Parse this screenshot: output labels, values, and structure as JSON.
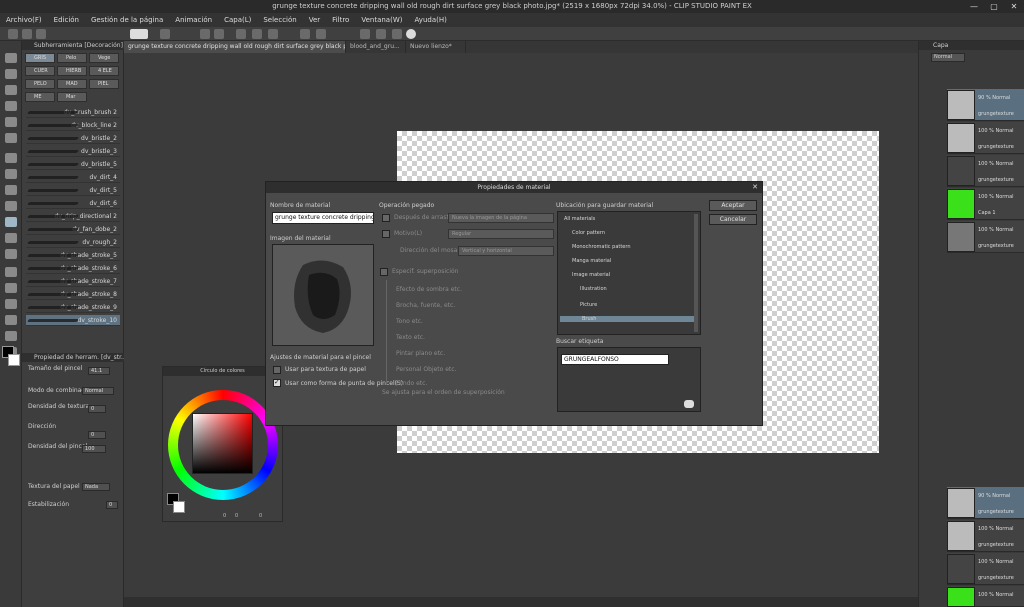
{
  "window": {
    "title": "grunge texture concrete dripping wall old rough dirt surface grey black photo.jpg* (2519 x 1680px 72dpi 34.0%) - CLIP STUDIO PAINT EX",
    "minimize": "—",
    "maximize": "▢",
    "close": "✕"
  },
  "menu": [
    "Archivo(F)",
    "Edición",
    "Gestión de la página",
    "Animación",
    "Capa(L)",
    "Selección",
    "Ver",
    "Filtro",
    "Ventana(W)",
    "Ayuda(H)"
  ],
  "tabs": [
    {
      "label": "grunge texture concrete dripping wall old rough dirt surface grey black photo.jpg*"
    },
    {
      "label": "blood_and_gru..."
    },
    {
      "label": "Nuevo lienzo*"
    }
  ],
  "subtool_panel": {
    "header": "Subherramienta [Decoración]",
    "groups": [
      "GRIS",
      "Pelo",
      "Vege",
      "CUER",
      "HIERB",
      "4 ELE",
      "PELO",
      "MAD",
      "PIEL",
      "ME",
      "Mar"
    ],
    "brushes": [
      "dv_brush_brush 2",
      "dv_block_line 2",
      "dv_bristle_2",
      "dv_bristle_3",
      "dv_bristle_5",
      "dv_dirt_4",
      "dv_dirt_5",
      "dv_dirt_6",
      "dv_drip_directional 2",
      "dv_fan_dobe_2",
      "dv_rough_2",
      "dv_shade_stroke_5",
      "dv_shade_stroke_6",
      "dv_shade_stroke_7",
      "dv_shade_stroke_8",
      "dv_shade_stroke_9",
      "dv_stroke_10"
    ]
  },
  "tool_property": {
    "header": "Propiedad de herram. [dv_str...]",
    "brush_size_label": "Tamaño del pincel",
    "brush_size_value": "41.1",
    "blend_label": "Modo de combinación",
    "blend_value": "Normal",
    "texture_density_label": "Densidad de textura",
    "texture_density_value": "0",
    "direction_label": "Dirección",
    "direction_value": "0",
    "brush_density_label": "Densidad del pincel",
    "brush_density_value": "100",
    "paper_texture_label": "Textura del papel",
    "paper_texture_value": "Nada",
    "stabilization_label": "Estabilización",
    "stabilization_value": "0"
  },
  "color_window": {
    "title": "Círculo de colores",
    "values": [
      "0",
      "0",
      "0"
    ]
  },
  "dialog": {
    "title": "Propiedades de material",
    "name_label": "Nombre de material",
    "name_value": "grunge texture concrete dripping wall",
    "image_label": "Imagen del material",
    "brush_settings_label": "Ajustes de material para el pincel",
    "paper_texture_checkbox": "Usar para textura de papel",
    "brush_tip_checkbox": "Usar como forma de punta de pincel(S)",
    "paste_op_label": "Operación pegado",
    "paste_option1": "Después de arrastrar",
    "paste_option1_value": "Nueva la imagen de la página",
    "pattern_label": "Motivo(L)",
    "pattern_value": "Regular",
    "tiling_label": "Dirección del mosaico",
    "tiling_value": "Vertical y horizontal",
    "overlay_label": "Especif. superposición",
    "overlay_options": [
      "Efecto de sombra etc.",
      "Brocha, fuente, etc.",
      "Tono etc.",
      "Texto etc.",
      "Pintar plano etc.",
      "Personal Objeto etc.",
      "Fondo etc.",
      "Se ajusta para el orden de superposición"
    ],
    "location_label": "Ubicación para guardar material",
    "tree": [
      "All materials",
      "Color pattern",
      "Monochromatic pattern",
      "Manga material",
      "Image material",
      "Illustration",
      "Picture",
      "Brush"
    ],
    "ok_button": "Aceptar",
    "cancel_button": "Cancelar",
    "tag_label": "Buscar etiqueta",
    "tag_value": "GRUNGEALFONSO"
  },
  "layers_panel": {
    "header": "Capa",
    "blend": "Normal",
    "items": [
      {
        "opacity": "90 % Normal",
        "name": "grungetexture"
      },
      {
        "opacity": "100 % Normal",
        "name": "grungetexture"
      },
      {
        "opacity": "100 % Normal",
        "name": "grungetexture"
      },
      {
        "opacity": "100 % Normal",
        "name": "Capa 1"
      },
      {
        "opacity": "100 % Normal",
        "name": "grungetexture"
      }
    ],
    "bottom_items": [
      {
        "opacity": "90 % Normal",
        "name": "grungetexture"
      },
      {
        "opacity": "100 % Normal",
        "name": "grungetexture"
      },
      {
        "opacity": "100 % Normal",
        "name": "grungetexture"
      },
      {
        "opacity": "100 % Normal",
        "name": "Capa 1"
      }
    ]
  },
  "colors": {
    "accent": "#5e7282",
    "green_layer": "#3ae01a",
    "dialog_bg": "#4a4a4a"
  }
}
